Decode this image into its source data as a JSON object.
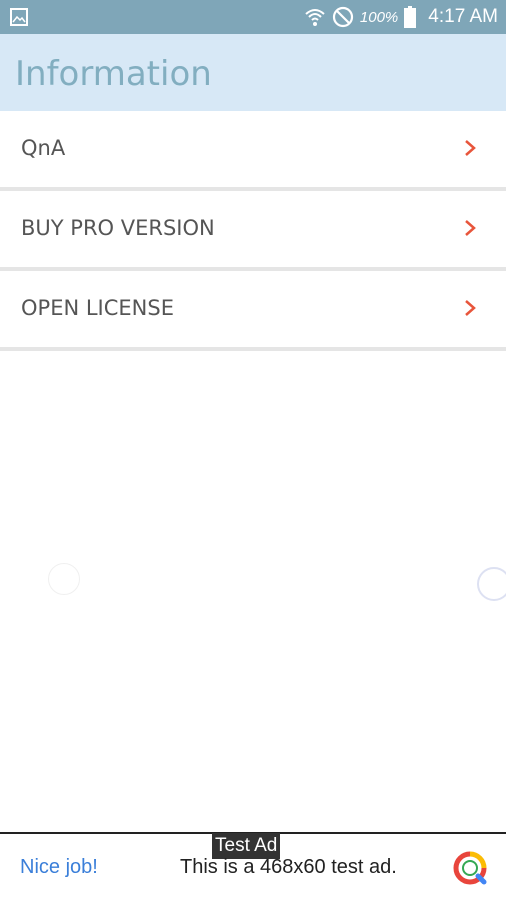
{
  "status_bar": {
    "battery_percent": "100%",
    "time": "4:17 AM",
    "icons": [
      "gallery-icon",
      "wifi-icon",
      "do-not-disturb-icon",
      "battery-icon"
    ]
  },
  "header": {
    "title": "Information"
  },
  "menu": {
    "items": [
      {
        "label": "QnA"
      },
      {
        "label": "BUY PRO VERSION"
      },
      {
        "label": "OPEN LICENSE"
      }
    ],
    "chevron_color": "#e8553b"
  },
  "ad": {
    "tag": "Test Ad",
    "cta": "Nice job!",
    "text": "This is a 468x60 test ad."
  },
  "colors": {
    "status_bar": "#7fa6b8",
    "header_bg": "#d7e8f6",
    "title": "#82aec0",
    "link": "#3b7fd9"
  }
}
